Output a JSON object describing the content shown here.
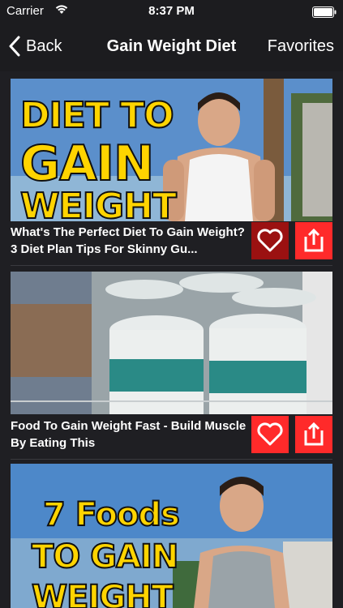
{
  "status_bar": {
    "carrier": "Carrier",
    "time": "8:37 PM"
  },
  "nav": {
    "back_label": "Back",
    "title": "Gain Weight Diet",
    "favorites_label": "Favorites"
  },
  "videos": [
    {
      "thumbnail_text": [
        "DIET TO",
        "GAIN",
        "WEIGHT"
      ],
      "caption": "What's The Perfect Diet To Gain Weight? 3 Diet Plan Tips For Skinny Gu...",
      "favorited": true
    },
    {
      "thumbnail_text": [],
      "caption": "Food To Gain Weight Fast - Build Muscle By Eating This",
      "favorited": false
    },
    {
      "thumbnail_text": [
        "7 Foods",
        "TO GAIN",
        "WEIGHT"
      ],
      "caption": "",
      "favorited": false
    }
  ],
  "colors": {
    "accent_red": "#ff2a2a",
    "favorited_red": "#9b1111",
    "background": "#1f1f23",
    "bar": "#1c1c1f"
  }
}
